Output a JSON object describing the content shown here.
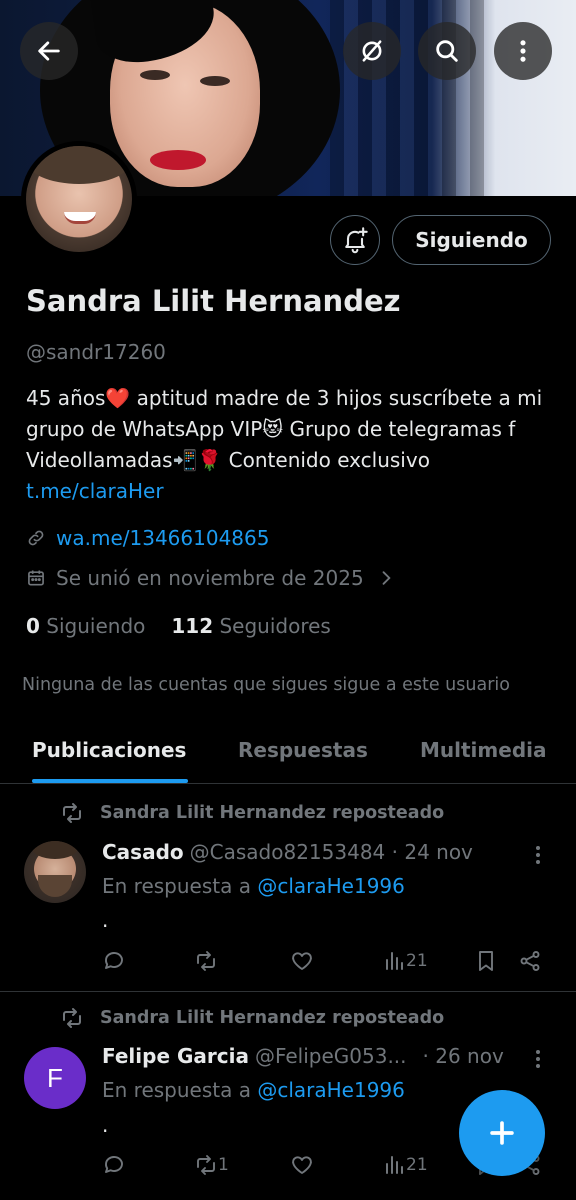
{
  "profile": {
    "name": "Sandra Lilit Hernandez",
    "handle": "@sandr17260",
    "bio_text": "45 años❤️ aptitud madre de 3 hijos suscríbete a mi grupo de WhatsApp VIP😻 Grupo de telegramas f Videollamadas📲🌹 Contenido exclusivo ",
    "bio_link": "t.me/claraHer",
    "website": "wa.me/13466104865",
    "joined": "Se unió en noviembre de 2025",
    "following_count": "0",
    "following_label": "Siguiendo",
    "followers_count": "112",
    "followers_label": "Seguidores",
    "mutual_notice": "Ninguna de las cuentas que sigues sigue a este usuario"
  },
  "header": {
    "follow_button_label": "Siguiendo",
    "icons": [
      "back-arrow-icon",
      "grok-icon",
      "search-icon",
      "more-vertical-icon"
    ]
  },
  "tabs": [
    {
      "label": "Publicaciones",
      "active": true
    },
    {
      "label": "Respuestas",
      "active": false
    },
    {
      "label": "Multimedia",
      "active": false
    }
  ],
  "posts": [
    {
      "repost_by": "Sandra Lilit Hernandez reposteado",
      "author_name": "Casado",
      "author_handle": "@Casado82153484 · 24 nov",
      "reply_prefix": "En respuesta a ",
      "reply_to": "@claraHe1996",
      "body": ".",
      "reposts": "",
      "views": "21"
    },
    {
      "repost_by": "Sandra Lilit Hernandez reposteado",
      "author_name": "Felipe Garcia",
      "author_handle": "@FelipeG053...",
      "date": "· 26 nov",
      "avatar_letter": "F",
      "reply_prefix": "En respuesta a ",
      "reply_to": "@claraHe1996",
      "body": ".",
      "reposts": "1",
      "views": "21"
    }
  ],
  "colors": {
    "accent": "#1d9bf0",
    "text_primary": "#e7e9ea",
    "text_secondary": "#71767b",
    "background": "#000000",
    "border": "#2f3336"
  }
}
